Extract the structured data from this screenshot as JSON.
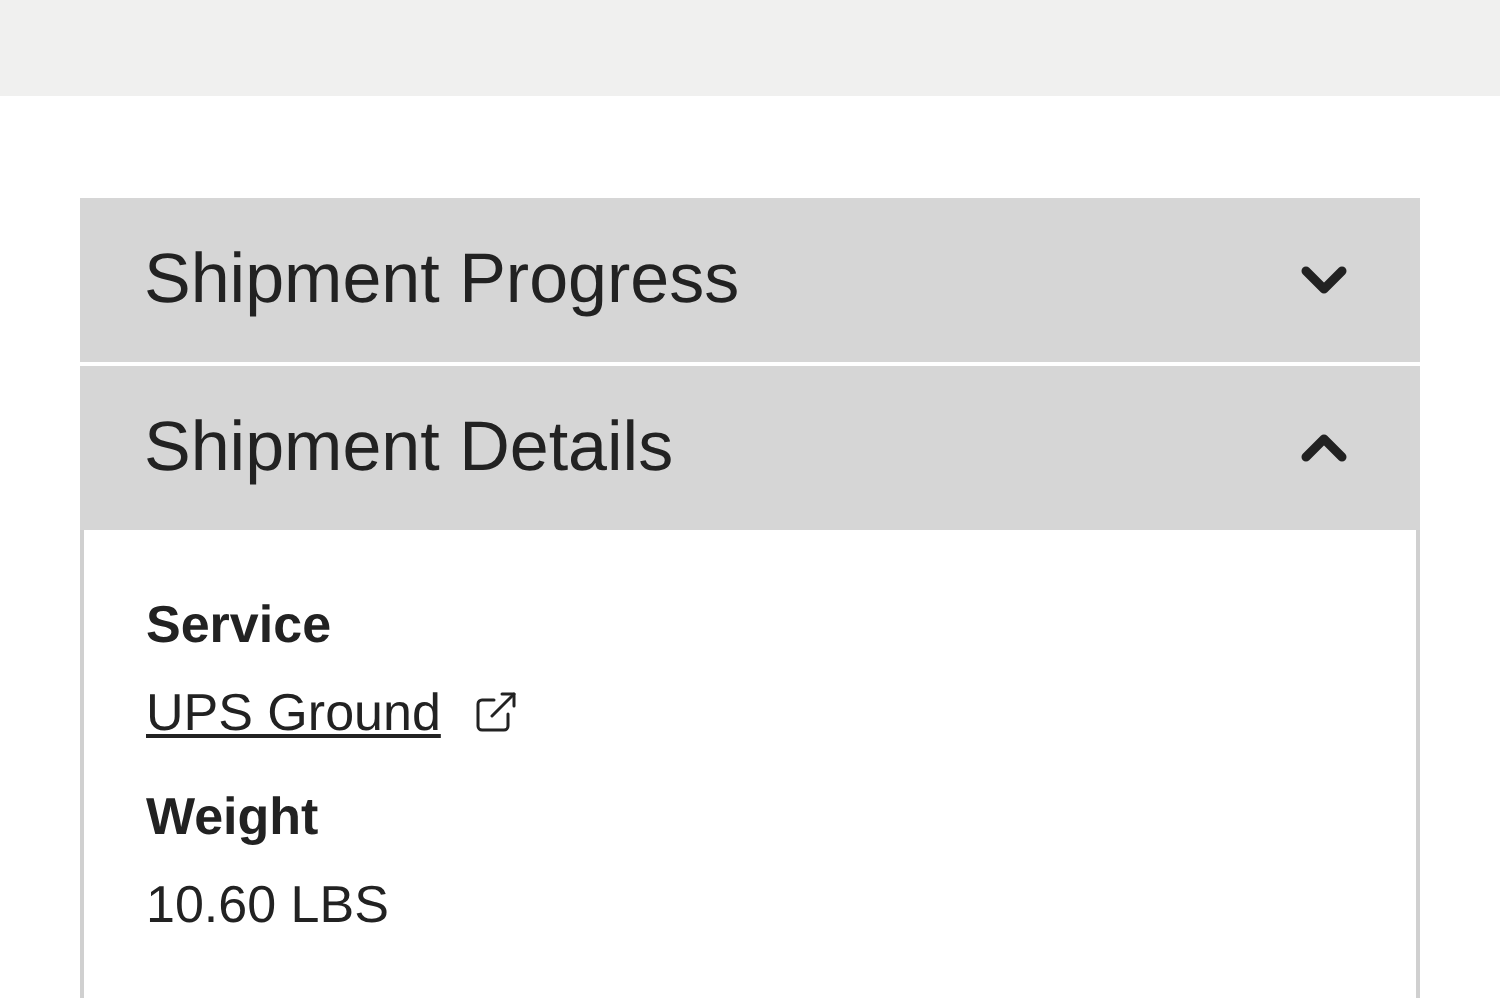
{
  "sections": [
    {
      "title": "Shipment Progress",
      "expanded": false
    },
    {
      "title": "Shipment Details",
      "expanded": true,
      "fields": [
        {
          "label": "Service",
          "value": "UPS Ground",
          "kind": "link"
        },
        {
          "label": "Weight",
          "value": "10.60 LBS",
          "kind": "text"
        }
      ]
    }
  ]
}
